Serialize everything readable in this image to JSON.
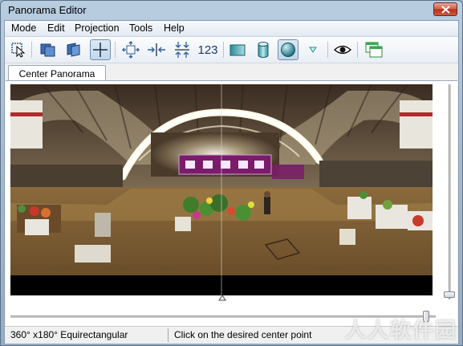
{
  "window": {
    "title": "Panorama Editor"
  },
  "menu": [
    "Mode",
    "Edit",
    "Projection",
    "Tools",
    "Help"
  ],
  "toolbar": {
    "number_label": "123",
    "icons": [
      "select-mode-icon",
      "images-mode-icon",
      "layers-mode-icon",
      "crosshair-mode-icon",
      "fit-icon",
      "center-horizontal-icon",
      "center-vertical-icon",
      "numbers-icon",
      "rectilinear-projection-icon",
      "cylindrical-projection-icon",
      "spherical-projection-icon",
      "projection-dropdown-icon",
      "preview-eye-icon",
      "windows-icon"
    ]
  },
  "tabs": [
    {
      "label": "Center Panorama"
    }
  ],
  "status": {
    "projection": "360° x180° Equirectangular",
    "hint": "Click on the desired center point"
  },
  "watermark": "人人软件园",
  "colors": {
    "accent": "#2f5e9c",
    "banner": "#7b1c6b"
  }
}
